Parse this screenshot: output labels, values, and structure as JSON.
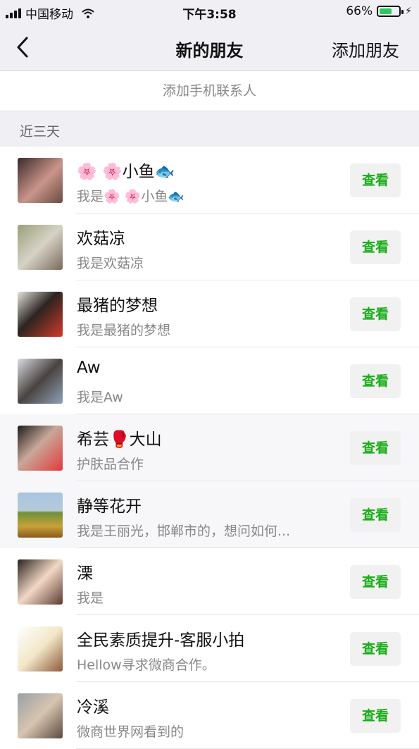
{
  "status_bar": {
    "carrier": "中国移动",
    "time": "下午3:58",
    "battery": "66%",
    "battery_level": 0.66
  },
  "nav": {
    "title": "新的朋友",
    "action": "添加朋友"
  },
  "add_phone_contacts": "添加手机联系人",
  "section_label": "近三天",
  "view_label": "查看",
  "requests": [
    {
      "name": "🌸 🌸小鱼🐟",
      "message": "我是🌸 🌸小鱼🐟"
    },
    {
      "name": "欢菇凉",
      "message": "我是欢菇凉"
    },
    {
      "name": "最猪的梦想",
      "message": "我是最猪的梦想"
    },
    {
      "name": "Aw",
      "message": "我是Aw"
    },
    {
      "name": "希芸🥊大山",
      "message": "护肤品合作"
    },
    {
      "name": "静等花开",
      "message": "我是王丽光，邯郸市的，想问如何..."
    },
    {
      "name": "溧",
      "message": "我是"
    },
    {
      "name": "全民素质提升-客服小拍",
      "message": "Hellow寻求微商合作。"
    },
    {
      "name": "冷溪",
      "message": "微商世界网看到的"
    }
  ],
  "colors": {
    "accent": "#1aad19",
    "battery": "#2ec95c"
  }
}
